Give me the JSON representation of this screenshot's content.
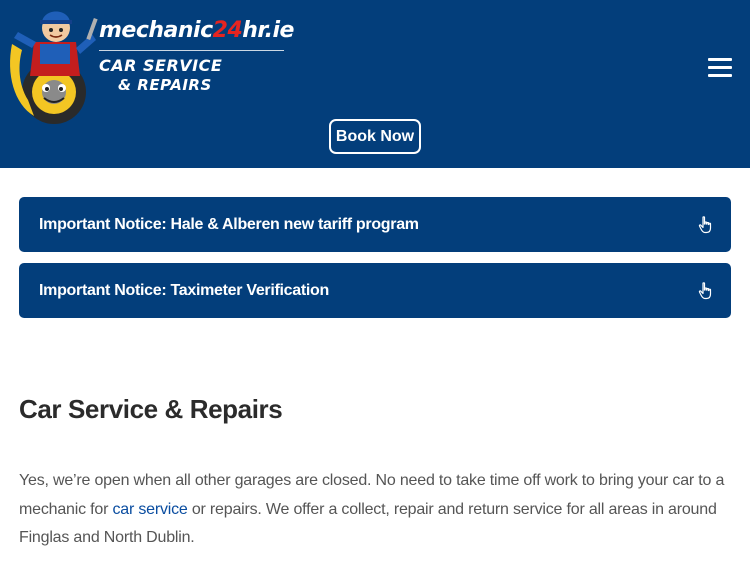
{
  "header": {
    "logo": {
      "brand_prefix": "mechanic",
      "brand_highlight": "24",
      "brand_suffix": "hr.ie",
      "tagline_line1": "CAR SERVICE",
      "tagline_line2": "& REPAIRS"
    },
    "book_now_label": "Book Now",
    "menu_icon": "hamburger-menu-icon"
  },
  "notices": [
    {
      "label": "Important Notice: Hale & Alberen new tariff program",
      "icon": "pointing-hand-icon"
    },
    {
      "label": "Important Notice: Taximeter Verification",
      "icon": "pointing-hand-icon"
    }
  ],
  "main": {
    "title": "Car Service & Repairs",
    "intro_before_link": "Yes, we’re open when all other garages are closed. No need to take time off work to bring your car to a mechanic for ",
    "intro_link": "car service",
    "intro_after_link": " or repairs. We offer a collect, repair and return service for all areas in around Finglas and North Dublin."
  },
  "colors": {
    "primary": "#033e7b",
    "brand_highlight": "#e52420",
    "link": "#0a4da0"
  }
}
